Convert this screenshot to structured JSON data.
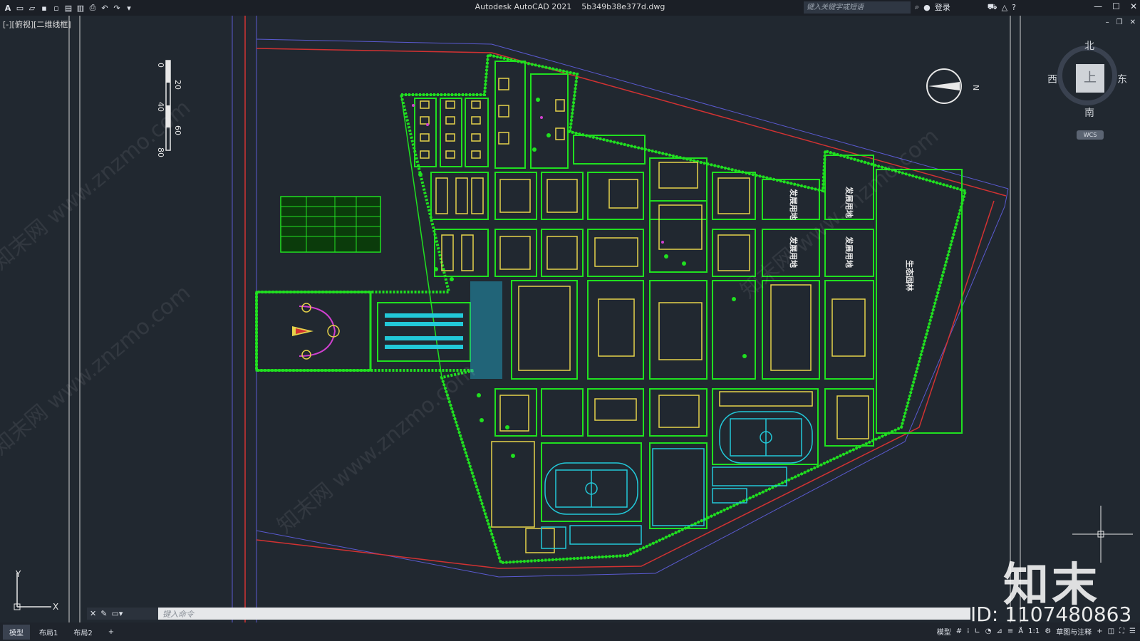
{
  "app": {
    "title": "Autodesk AutoCAD 2021",
    "filename": "5b349b38e377d.dwg",
    "search_placeholder": "键入关键字或短语",
    "login_label": "登录",
    "view_label": "[-][俯视][二维线框]",
    "logo": "A"
  },
  "viewcube": {
    "north": "北",
    "south": "南",
    "east": "东",
    "west": "西",
    "face": "上",
    "wcs": "WCS"
  },
  "command": {
    "placeholder": "键入命令"
  },
  "status": {
    "tabs": [
      "模型",
      "布局1",
      "布局2"
    ],
    "add_tab": "+",
    "model_label": "模型",
    "scale": "1:1",
    "workspace": "草图与注释"
  },
  "drawing": {
    "scale_bar": [
      "0",
      "20",
      "40",
      "60",
      "80"
    ],
    "north_label": "N",
    "labels": {
      "reserve1": "发展用地",
      "reserve2": "发展用地",
      "reserve3": "发展用地",
      "reserve4": "发展用地",
      "ecology": "生态园林"
    }
  },
  "watermark": {
    "brand": "知末",
    "id": "ID: 1107480863",
    "repeat": "知末网 www.znzmo.com"
  },
  "colors": {
    "background": "#212830",
    "green": "#20e020",
    "yellow": "#e6d24a",
    "magenta": "#d040d0",
    "cyan": "#22c8d8",
    "red": "#d23232"
  }
}
